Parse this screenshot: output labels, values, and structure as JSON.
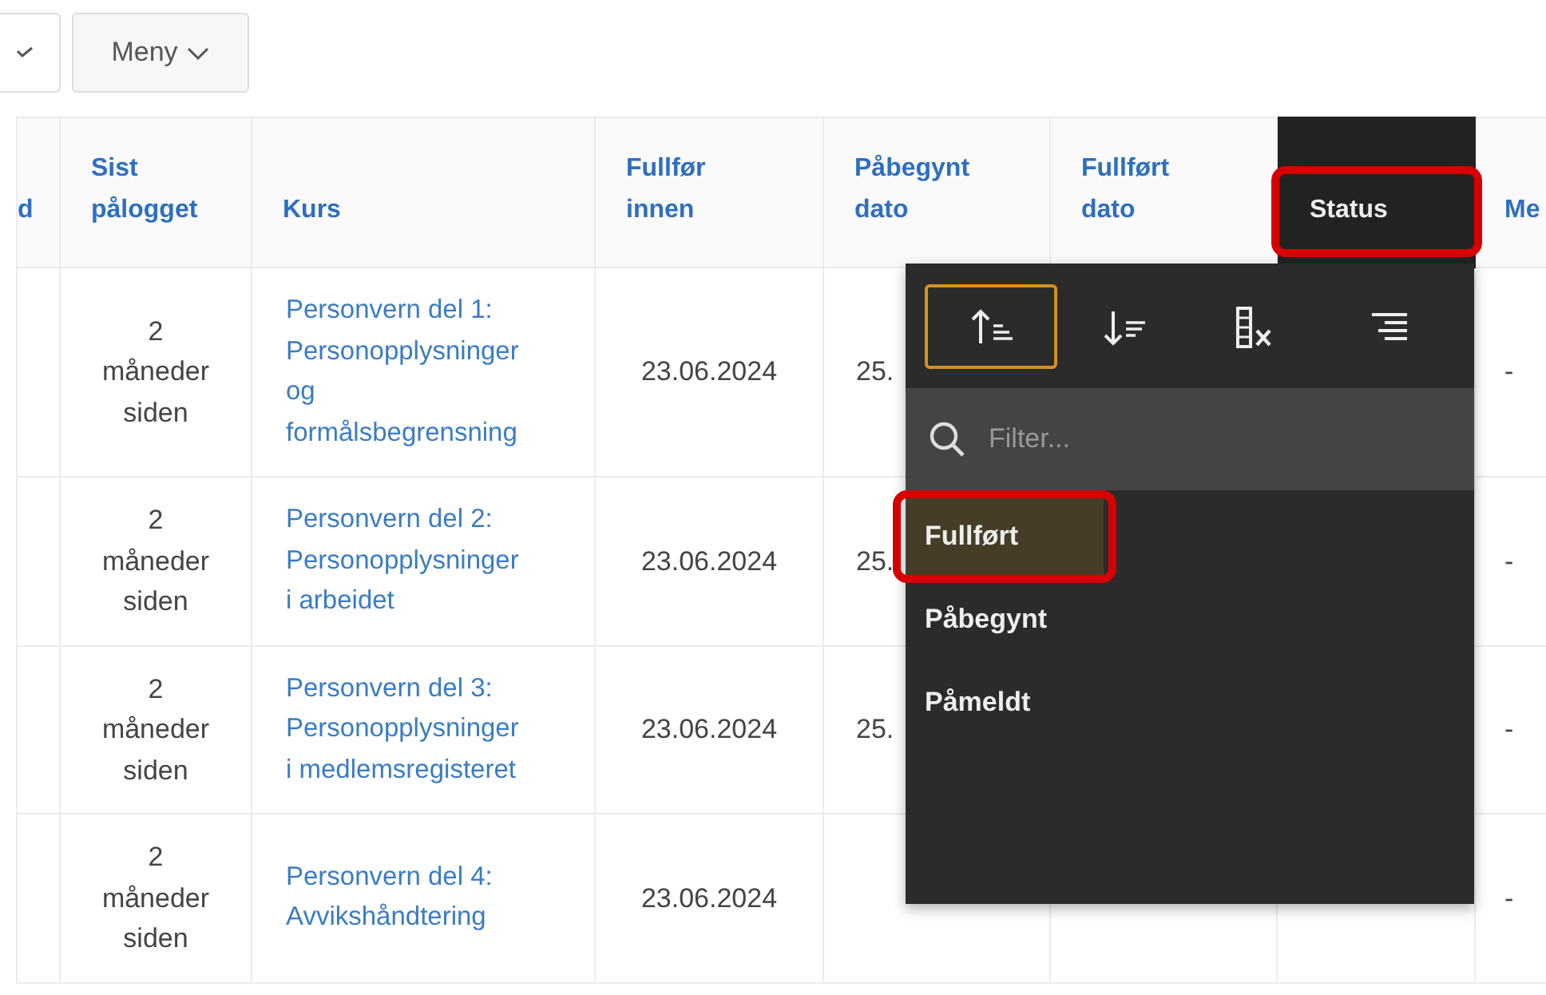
{
  "toolbar": {
    "menu_button": {
      "label": "Meny"
    }
  },
  "table": {
    "columns": [
      {
        "label": "d",
        "menu_open": false,
        "annotated": false
      },
      {
        "label": "Sist pålogget",
        "menu_open": false,
        "annotated": false
      },
      {
        "label": "Kurs",
        "menu_open": false,
        "annotated": false
      },
      {
        "label": "Fullfør innen",
        "menu_open": false,
        "annotated": false
      },
      {
        "label": "Påbegynt dato",
        "menu_open": false,
        "annotated": false
      },
      {
        "label": "Fullført dato",
        "menu_open": false,
        "annotated": false
      },
      {
        "label": "Status",
        "menu_open": true,
        "annotated": true
      },
      {
        "label": "Me",
        "menu_open": false,
        "annotated": false
      }
    ],
    "rows": [
      [
        null,
        "2 måneder siden",
        "Personvern del 1: Personopplysninger og formålsbegrensning",
        "23.06.2024",
        "25.",
        null,
        null,
        "-"
      ],
      [
        null,
        "2 måneder siden",
        "Personvern del 2: Personopplysninger i arbeidet",
        "23.06.2024",
        "25.",
        null,
        null,
        "-"
      ],
      [
        null,
        "2 måneder siden",
        "Personvern del 3: Personopplysninger i medlemsregisteret",
        "23.06.2024",
        "25.",
        null,
        null,
        "-"
      ],
      [
        null,
        "2 måneder siden",
        "Personvern del 4: Avvikshåndtering",
        "23.06.2024",
        null,
        null,
        null,
        "-"
      ]
    ]
  },
  "column_menu": {
    "actions": [
      {
        "kind": "sort-asc",
        "selected": true
      },
      {
        "kind": "sort-desc",
        "selected": false
      },
      {
        "kind": "hide-column",
        "selected": false
      },
      {
        "kind": "align",
        "selected": false
      }
    ],
    "filter": {
      "placeholder": "Filter..."
    },
    "items": [
      {
        "label": "Fullført",
        "selected": true,
        "annotated": true
      },
      {
        "label": "Påbegynt",
        "selected": false,
        "annotated": false
      },
      {
        "label": "Påmeldt",
        "selected": false,
        "annotated": false
      }
    ]
  }
}
